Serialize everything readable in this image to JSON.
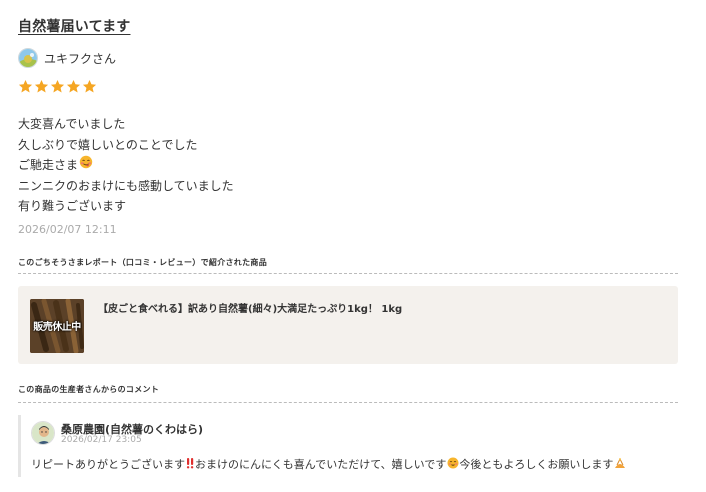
{
  "review": {
    "title": "自然薯届いてます",
    "reviewer_name": "ユキフクさん",
    "rating": 5,
    "body_lines": [
      "大変喜んでいました",
      "久しぶりで嬉しいとのことでした",
      "ご馳走さま",
      "ニンニクのおまけにも感動していました",
      "有り難うございます"
    ],
    "date": "2026/02/07 12:11"
  },
  "product_section": {
    "label": "このごちそうさまレポート（口コミ・レビュー）で紹介された商品",
    "product_title": "【皮ごと食べれる】訳あり自然薯(細々)大満足たっぷり1kg！ 1kg",
    "sold_out_label": "販売休止中"
  },
  "comment_section": {
    "label": "この商品の生産者さんからのコメント",
    "producer_name": "桑原農園(自然薯のくわはら)",
    "date": "2026/02/17 23:05",
    "text_part1": "リピートありがとうございます",
    "text_part2": " おまけのにんにくも喜んでいただけて、嬉しいです",
    "text_part3": " 今後ともよろしくお願いします"
  },
  "colors": {
    "star": "#f5a623",
    "card_bg": "#f4f1ed",
    "muted_text": "#aaaaaa"
  },
  "icons": [
    "reviewer-avatar-icon",
    "star-icon",
    "yum-face-emoji-icon",
    "producer-avatar-icon",
    "double-exclamation-emoji-icon",
    "smile-emoji-icon",
    "bowing-emoji-icon"
  ]
}
